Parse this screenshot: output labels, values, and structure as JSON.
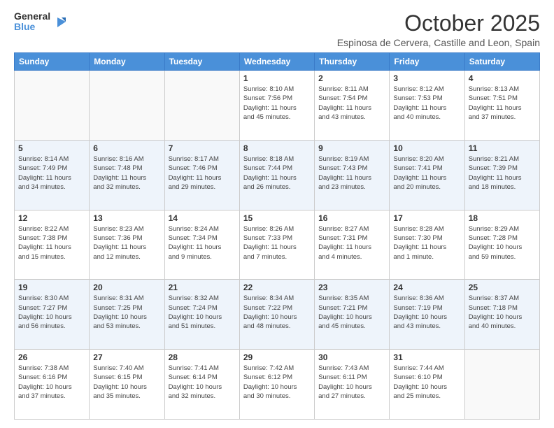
{
  "logo": {
    "line1": "General",
    "line2": "Blue"
  },
  "title": "October 2025",
  "location": "Espinosa de Cervera, Castille and Leon, Spain",
  "weekdays": [
    "Sunday",
    "Monday",
    "Tuesday",
    "Wednesday",
    "Thursday",
    "Friday",
    "Saturday"
  ],
  "weeks": [
    [
      {
        "day": "",
        "info": ""
      },
      {
        "day": "",
        "info": ""
      },
      {
        "day": "",
        "info": ""
      },
      {
        "day": "1",
        "info": "Sunrise: 8:10 AM\nSunset: 7:56 PM\nDaylight: 11 hours\nand 45 minutes."
      },
      {
        "day": "2",
        "info": "Sunrise: 8:11 AM\nSunset: 7:54 PM\nDaylight: 11 hours\nand 43 minutes."
      },
      {
        "day": "3",
        "info": "Sunrise: 8:12 AM\nSunset: 7:53 PM\nDaylight: 11 hours\nand 40 minutes."
      },
      {
        "day": "4",
        "info": "Sunrise: 8:13 AM\nSunset: 7:51 PM\nDaylight: 11 hours\nand 37 minutes."
      }
    ],
    [
      {
        "day": "5",
        "info": "Sunrise: 8:14 AM\nSunset: 7:49 PM\nDaylight: 11 hours\nand 34 minutes."
      },
      {
        "day": "6",
        "info": "Sunrise: 8:16 AM\nSunset: 7:48 PM\nDaylight: 11 hours\nand 32 minutes."
      },
      {
        "day": "7",
        "info": "Sunrise: 8:17 AM\nSunset: 7:46 PM\nDaylight: 11 hours\nand 29 minutes."
      },
      {
        "day": "8",
        "info": "Sunrise: 8:18 AM\nSunset: 7:44 PM\nDaylight: 11 hours\nand 26 minutes."
      },
      {
        "day": "9",
        "info": "Sunrise: 8:19 AM\nSunset: 7:43 PM\nDaylight: 11 hours\nand 23 minutes."
      },
      {
        "day": "10",
        "info": "Sunrise: 8:20 AM\nSunset: 7:41 PM\nDaylight: 11 hours\nand 20 minutes."
      },
      {
        "day": "11",
        "info": "Sunrise: 8:21 AM\nSunset: 7:39 PM\nDaylight: 11 hours\nand 18 minutes."
      }
    ],
    [
      {
        "day": "12",
        "info": "Sunrise: 8:22 AM\nSunset: 7:38 PM\nDaylight: 11 hours\nand 15 minutes."
      },
      {
        "day": "13",
        "info": "Sunrise: 8:23 AM\nSunset: 7:36 PM\nDaylight: 11 hours\nand 12 minutes."
      },
      {
        "day": "14",
        "info": "Sunrise: 8:24 AM\nSunset: 7:34 PM\nDaylight: 11 hours\nand 9 minutes."
      },
      {
        "day": "15",
        "info": "Sunrise: 8:26 AM\nSunset: 7:33 PM\nDaylight: 11 hours\nand 7 minutes."
      },
      {
        "day": "16",
        "info": "Sunrise: 8:27 AM\nSunset: 7:31 PM\nDaylight: 11 hours\nand 4 minutes."
      },
      {
        "day": "17",
        "info": "Sunrise: 8:28 AM\nSunset: 7:30 PM\nDaylight: 11 hours\nand 1 minute."
      },
      {
        "day": "18",
        "info": "Sunrise: 8:29 AM\nSunset: 7:28 PM\nDaylight: 10 hours\nand 59 minutes."
      }
    ],
    [
      {
        "day": "19",
        "info": "Sunrise: 8:30 AM\nSunset: 7:27 PM\nDaylight: 10 hours\nand 56 minutes."
      },
      {
        "day": "20",
        "info": "Sunrise: 8:31 AM\nSunset: 7:25 PM\nDaylight: 10 hours\nand 53 minutes."
      },
      {
        "day": "21",
        "info": "Sunrise: 8:32 AM\nSunset: 7:24 PM\nDaylight: 10 hours\nand 51 minutes."
      },
      {
        "day": "22",
        "info": "Sunrise: 8:34 AM\nSunset: 7:22 PM\nDaylight: 10 hours\nand 48 minutes."
      },
      {
        "day": "23",
        "info": "Sunrise: 8:35 AM\nSunset: 7:21 PM\nDaylight: 10 hours\nand 45 minutes."
      },
      {
        "day": "24",
        "info": "Sunrise: 8:36 AM\nSunset: 7:19 PM\nDaylight: 10 hours\nand 43 minutes."
      },
      {
        "day": "25",
        "info": "Sunrise: 8:37 AM\nSunset: 7:18 PM\nDaylight: 10 hours\nand 40 minutes."
      }
    ],
    [
      {
        "day": "26",
        "info": "Sunrise: 7:38 AM\nSunset: 6:16 PM\nDaylight: 10 hours\nand 37 minutes."
      },
      {
        "day": "27",
        "info": "Sunrise: 7:40 AM\nSunset: 6:15 PM\nDaylight: 10 hours\nand 35 minutes."
      },
      {
        "day": "28",
        "info": "Sunrise: 7:41 AM\nSunset: 6:14 PM\nDaylight: 10 hours\nand 32 minutes."
      },
      {
        "day": "29",
        "info": "Sunrise: 7:42 AM\nSunset: 6:12 PM\nDaylight: 10 hours\nand 30 minutes."
      },
      {
        "day": "30",
        "info": "Sunrise: 7:43 AM\nSunset: 6:11 PM\nDaylight: 10 hours\nand 27 minutes."
      },
      {
        "day": "31",
        "info": "Sunrise: 7:44 AM\nSunset: 6:10 PM\nDaylight: 10 hours\nand 25 minutes."
      },
      {
        "day": "",
        "info": ""
      }
    ]
  ]
}
